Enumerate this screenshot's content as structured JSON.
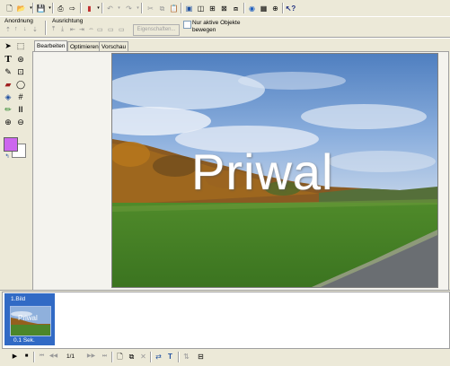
{
  "toolbar": {
    "anordnung_label": "Anordnung",
    "ausrichtung_label": "Ausrichtung",
    "eigenschaften_label": "Eigenschaften...",
    "nur_aktive_label_line1": "Nur aktive Objekte",
    "nur_aktive_label_line2": "bewegen"
  },
  "tabs": [
    {
      "label": "Bearbeiten"
    },
    {
      "label": "Optimieren"
    },
    {
      "label": "Vorschau"
    }
  ],
  "canvas": {
    "overlay_text": "Priwal"
  },
  "timeline": {
    "slide_title": "1.Bild",
    "slide_duration": "0.1 Sek.",
    "thumb_text": "Priwal"
  },
  "playback": {
    "frame_counter": "1/1"
  },
  "colors": {
    "window_bg": "#ece9d8",
    "selection_blue": "#316ac5",
    "fill_color": "#cc66ee",
    "canvas_frame": "#808080"
  }
}
